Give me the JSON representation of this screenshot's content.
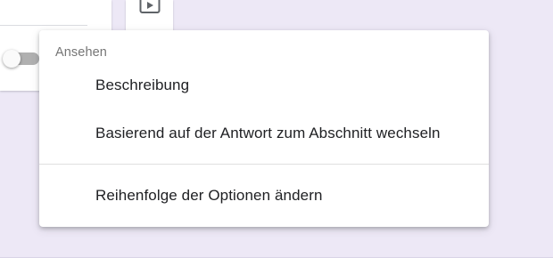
{
  "menu": {
    "header": "Ansehen",
    "items": [
      {
        "label": "Beschreibung"
      },
      {
        "label": "Basierend auf der Antwort zum Abschnitt wechseln"
      },
      {
        "label": "Reihenfolge der Optionen ändern"
      }
    ]
  },
  "background": {
    "toggle_state": "off",
    "toolbar_icon": "video-icon"
  },
  "colors": {
    "page_background": "#ede8f6",
    "menu_background": "#ffffff",
    "text_primary": "#202124",
    "text_secondary": "#757575"
  }
}
